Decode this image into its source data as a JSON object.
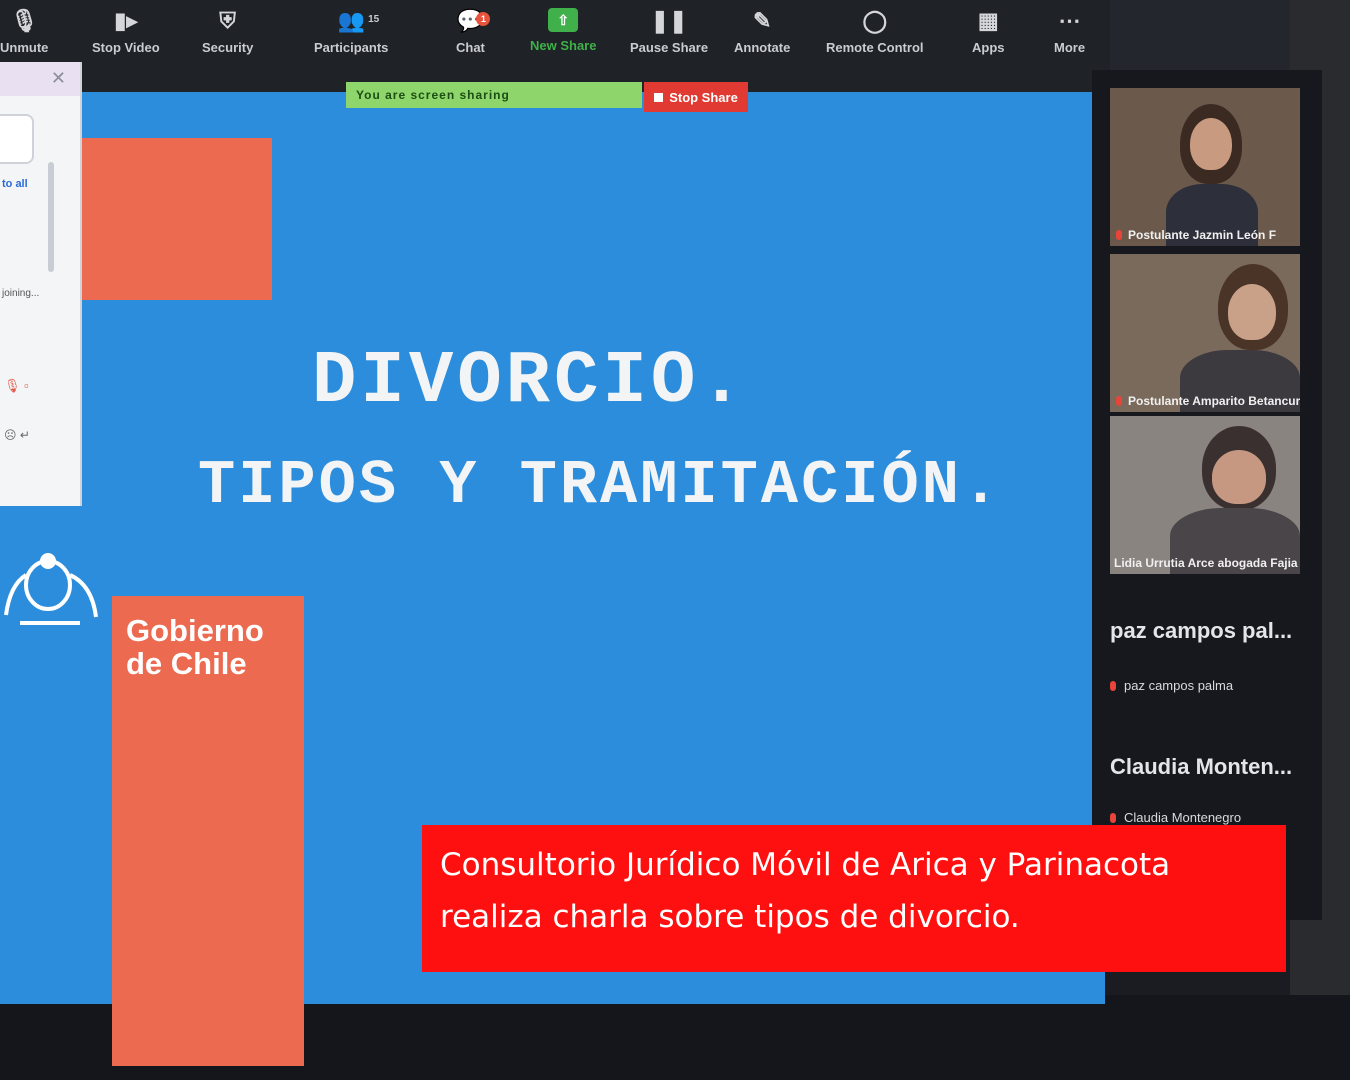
{
  "toolbar": {
    "items": [
      {
        "label": "Unmute",
        "icon": "mic-muted-icon"
      },
      {
        "label": "Stop Video",
        "icon": "video-camera-icon"
      },
      {
        "label": "Security",
        "icon": "shield-icon"
      },
      {
        "label": "Participants",
        "icon": "participants-icon",
        "count": "15"
      },
      {
        "label": "Chat",
        "icon": "chat-icon",
        "badge": "1"
      },
      {
        "label": "New Share",
        "icon": "share-screen-icon"
      },
      {
        "label": "Pause Share",
        "icon": "pause-icon"
      },
      {
        "label": "Annotate",
        "icon": "pen-icon"
      },
      {
        "label": "Remote Control",
        "icon": "mouse-icon"
      },
      {
        "label": "Apps",
        "icon": "apps-icon"
      },
      {
        "label": "More",
        "icon": "more-icon"
      }
    ],
    "share_strip_text": "You are screen sharing",
    "stop_share_label": "Stop Share"
  },
  "chat_panel": {
    "link_text": "to all",
    "status_text": "joining..."
  },
  "slide": {
    "title": "DIVORCIO.",
    "subtitle": "TIPOS Y TRAMITACIÓN.",
    "logo_text_line1": "Gobierno",
    "logo_text_line2": "de Chile",
    "colors": {
      "background": "#2b8ddb",
      "accent": "#ec6a4f"
    }
  },
  "participants": {
    "video_tiles": [
      {
        "label": "Postulante Jazmin León F"
      },
      {
        "label": "Postulante Amparito Betancur F"
      },
      {
        "label": "Lidia Urrutia Arce abogada Fajia"
      }
    ],
    "name_tiles": [
      {
        "display": "paz campos pal...",
        "name": "paz campos palma"
      },
      {
        "display": "Claudia Monten...",
        "name": "Claudia Montenegro"
      }
    ]
  },
  "caption": {
    "line1": "Consultorio Jurídico Móvil de Arica y Parinacota",
    "line2": "realiza charla sobre tipos de divorcio.",
    "color": "#ff1010"
  }
}
